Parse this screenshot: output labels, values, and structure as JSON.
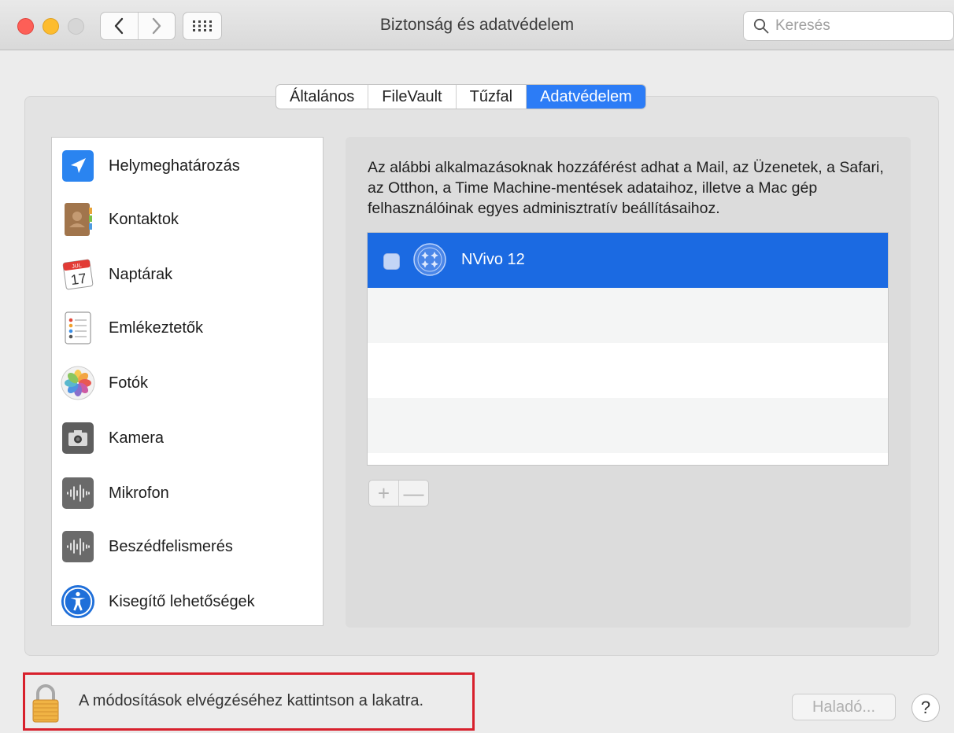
{
  "window": {
    "title": "Biztonság és adatvédelem",
    "search_placeholder": "Keresés"
  },
  "tabs": [
    {
      "label": "Általános",
      "active": false
    },
    {
      "label": "FileVault",
      "active": false
    },
    {
      "label": "Tűzfal",
      "active": false
    },
    {
      "label": "Adatvédelem",
      "active": true
    }
  ],
  "sidebar": {
    "items": [
      {
        "label": "Helymeghatározás",
        "icon": "location-arrow-icon"
      },
      {
        "label": "Kontaktok",
        "icon": "contacts-book-icon"
      },
      {
        "label": "Naptárak",
        "icon": "calendar-icon",
        "icon_month": "JUL",
        "icon_day": "17"
      },
      {
        "label": "Emlékeztetők",
        "icon": "reminders-icon"
      },
      {
        "label": "Fotók",
        "icon": "photos-icon"
      },
      {
        "label": "Kamera",
        "icon": "camera-icon"
      },
      {
        "label": "Mikrofon",
        "icon": "microphone-waveform-icon"
      },
      {
        "label": "Beszédfelismerés",
        "icon": "speech-recognition-icon"
      },
      {
        "label": "Kisegítő lehetőségek",
        "icon": "accessibility-icon"
      }
    ]
  },
  "main": {
    "description": "Az alábbi alkalmazásoknak hozzáférést adhat a Mail, az Üzenetek, a Safari, az Otthon, a Time Machine-mentések adataihoz, illetve a Mac gép felhasználóinak egyes adminisztratív beállításaihoz.",
    "apps": [
      {
        "name": "NVivo 12",
        "checked": false,
        "selected": true
      }
    ],
    "add_label": "+",
    "remove_label": "—"
  },
  "footer": {
    "lock_text": "A módosítások elvégzéséhez kattintson a lakatra.",
    "advanced_label": "Haladó...",
    "help_label": "?"
  },
  "colors": {
    "accent": "#2c7cf6",
    "selection": "#1b6ae2",
    "highlight_box": "#d8202c"
  }
}
